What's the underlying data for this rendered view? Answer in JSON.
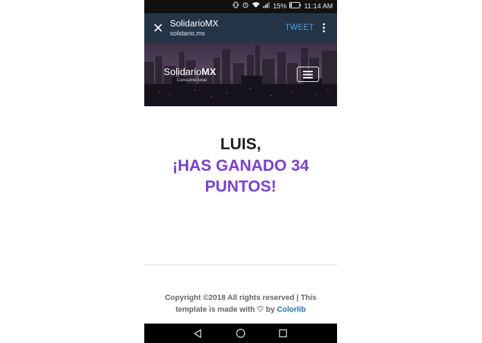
{
  "status_bar": {
    "battery": "15%",
    "time": "11:14 AM",
    "icons": [
      "vibrate-icon",
      "alarm-icon",
      "wifi-icon",
      "signal-icon",
      "battery-icon"
    ]
  },
  "toolbar": {
    "title": "SolidarioMX",
    "url": "solidario.mx",
    "tweet_label": "TWEET",
    "close_icon": "close-icon",
    "more_icon": "more-vert-icon"
  },
  "hero": {
    "logo_light": "Solidario",
    "logo_bold": "MX",
    "tagline": "Consume local",
    "menu_icon": "hamburger-menu-icon"
  },
  "main": {
    "name_line": "LUIS,",
    "points_line": "¡HAS GANADO 34 PUNTOS!"
  },
  "footer": {
    "text_before": "Copyright ©2018 All rights reserved | This template is made with",
    "heart_icon": "♡",
    "text_by": "by",
    "link": "Colorlib"
  },
  "nav_bar": {
    "icons": [
      "back-icon",
      "home-icon",
      "recents-icon"
    ]
  },
  "colors": {
    "toolbar_bg": "#243447",
    "tweet": "#4aa3e6",
    "accent_purple": "#7a3ee0",
    "link_blue": "#1a73c8"
  }
}
